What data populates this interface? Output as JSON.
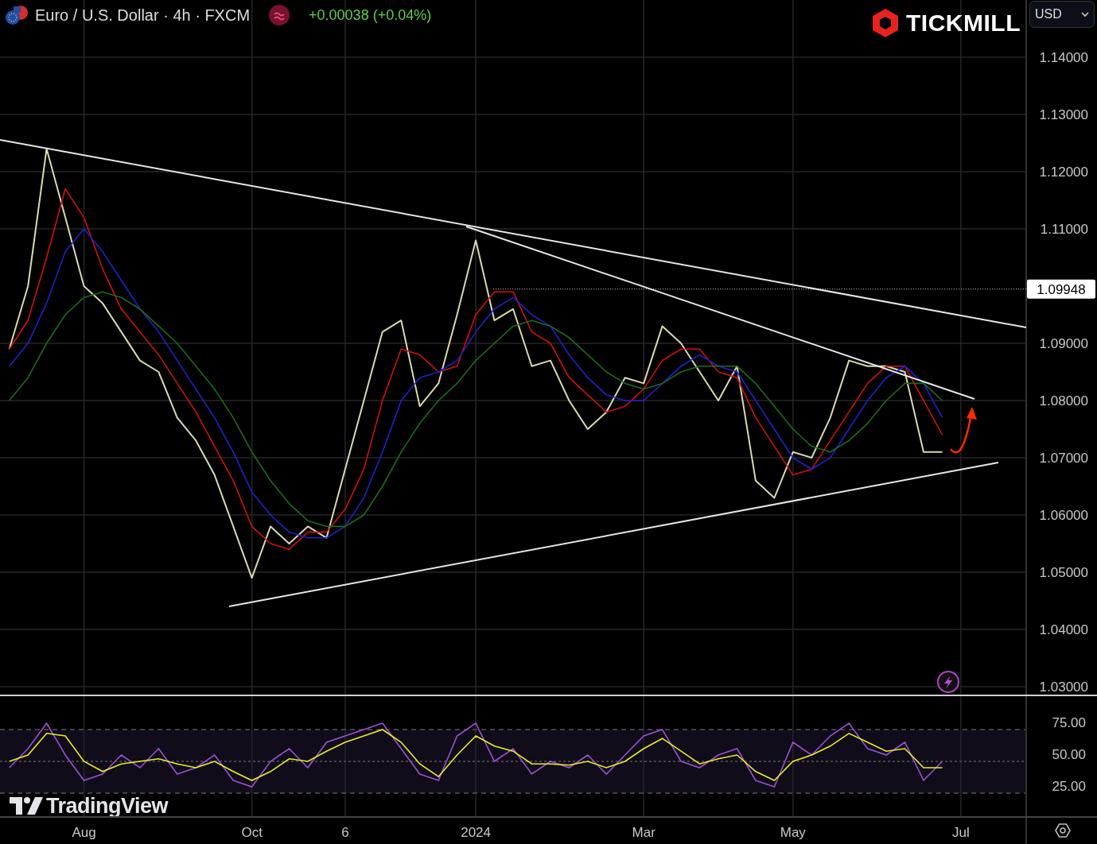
{
  "header": {
    "symbol_title": "Euro / U.S. Dollar · 4h · FXCM",
    "change": "+0.00038 (+0.04%)"
  },
  "broker_logo": {
    "text": "TICKMILL"
  },
  "currency_select": {
    "value": "USD"
  },
  "price_chart": {
    "chart_data": {
      "type": "line",
      "grid": true,
      "categories": [
        null,
        null,
        null,
        null,
        "Aug",
        null,
        null,
        null,
        null,
        null,
        null,
        null,
        null,
        "Oct",
        null,
        null,
        null,
        null,
        "6",
        null,
        null,
        null,
        null,
        null,
        null,
        "2024",
        null,
        null,
        null,
        null,
        null,
        null,
        null,
        null,
        "Mar",
        null,
        null,
        null,
        null,
        null,
        null,
        null,
        "May",
        null,
        null,
        null,
        null,
        null,
        null,
        null,
        null,
        "Jul",
        null,
        null,
        null
      ],
      "ylim": [
        1.02833,
        1.15
      ],
      "yticks": [
        {
          "value": 1.14,
          "label": "1.14000"
        },
        {
          "value": 1.13,
          "label": "1.13000"
        },
        {
          "value": 1.12,
          "label": "1.12000"
        },
        {
          "value": 1.11,
          "label": "1.11000"
        },
        {
          "value": 1.09,
          "label": "1.09000"
        },
        {
          "value": 1.08,
          "label": "1.08000"
        },
        {
          "value": 1.07,
          "label": "1.07000"
        },
        {
          "value": 1.06,
          "label": "1.06000"
        },
        {
          "value": 1.05,
          "label": "1.05000"
        },
        {
          "value": 1.04,
          "label": "1.04000"
        },
        {
          "value": 1.03,
          "label": "1.03000"
        }
      ],
      "series": [
        {
          "color": "#d9d9b0",
          "values": [
            1.089,
            1.1,
            1.124,
            1.112,
            1.1,
            1.097,
            1.092,
            1.087,
            1.085,
            1.077,
            1.073,
            1.067,
            1.058,
            1.049,
            1.058,
            1.055,
            1.058,
            1.056,
            1.068,
            1.08,
            1.092,
            1.094,
            1.079,
            1.083,
            1.095,
            1.108,
            1.094,
            1.096,
            1.086,
            1.087,
            1.08,
            1.075,
            1.078,
            1.084,
            1.083,
            1.093,
            1.09,
            1.085,
            1.08,
            1.086,
            1.066,
            1.063,
            1.071,
            1.07,
            1.077,
            1.087,
            1.086,
            1.086,
            1.085,
            1.071,
            1.071,
            null,
            null,
            null,
            null
          ]
        },
        {
          "color": "#d01010",
          "values": [
            1.089,
            1.094,
            1.105,
            1.117,
            1.112,
            1.103,
            1.096,
            1.092,
            1.088,
            1.083,
            1.078,
            1.072,
            1.066,
            1.058,
            1.055,
            1.054,
            1.057,
            1.057,
            1.061,
            1.068,
            1.08,
            1.089,
            1.088,
            1.085,
            1.086,
            1.095,
            1.099,
            1.099,
            1.092,
            1.09,
            1.084,
            1.081,
            1.078,
            1.079,
            1.082,
            1.087,
            1.089,
            1.089,
            1.085,
            1.084,
            1.077,
            1.072,
            1.067,
            1.068,
            1.073,
            1.078,
            1.083,
            1.086,
            1.086,
            1.08,
            1.074,
            null,
            null,
            null,
            null
          ]
        },
        {
          "color": "#2020d0",
          "values": [
            1.086,
            1.09,
            1.097,
            1.106,
            1.11,
            1.106,
            1.101,
            1.096,
            1.092,
            1.087,
            1.082,
            1.077,
            1.071,
            1.064,
            1.06,
            1.057,
            1.056,
            1.056,
            1.058,
            1.063,
            1.071,
            1.08,
            1.084,
            1.085,
            1.087,
            1.092,
            1.096,
            1.098,
            1.095,
            1.093,
            1.088,
            1.084,
            1.081,
            1.08,
            1.08,
            1.083,
            1.086,
            1.088,
            1.086,
            1.085,
            1.08,
            1.075,
            1.07,
            1.068,
            1.07,
            1.075,
            1.08,
            1.084,
            1.086,
            1.083,
            1.077,
            null,
            null,
            null,
            null
          ]
        },
        {
          "color": "#1d6b1d",
          "values": [
            1.08,
            1.084,
            1.09,
            1.095,
            1.098,
            1.099,
            1.098,
            1.096,
            1.093,
            1.09,
            1.086,
            1.082,
            1.077,
            1.071,
            1.066,
            1.062,
            1.059,
            1.058,
            1.058,
            1.06,
            1.065,
            1.071,
            1.076,
            1.08,
            1.083,
            1.087,
            1.09,
            1.093,
            1.094,
            1.093,
            1.091,
            1.088,
            1.085,
            1.083,
            1.082,
            1.083,
            1.085,
            1.086,
            1.086,
            1.086,
            1.083,
            1.079,
            1.075,
            1.072,
            1.071,
            1.073,
            1.076,
            1.08,
            1.083,
            1.083,
            1.08,
            null,
            null,
            null,
            null
          ]
        }
      ]
    },
    "price_level": {
      "label": "1.09948"
    }
  },
  "rsi_chart": {
    "chart_data": {
      "type": "line",
      "grid": true,
      "ylim": [
        7.5,
        101.25
      ],
      "yticks": [
        {
          "value": 75,
          "label": "75.00"
        },
        {
          "value": 50,
          "label": "50.00"
        },
        {
          "value": 25,
          "label": "25.00"
        }
      ],
      "series": [
        {
          "color": "#9b4fd6",
          "values": [
            45,
            60,
            80,
            55,
            35,
            40,
            55,
            45,
            60,
            40,
            45,
            55,
            35,
            30,
            50,
            60,
            45,
            65,
            70,
            75,
            80,
            60,
            40,
            35,
            70,
            80,
            50,
            60,
            40,
            50,
            45,
            55,
            40,
            55,
            70,
            75,
            50,
            45,
            55,
            60,
            35,
            30,
            65,
            55,
            70,
            80,
            60,
            55,
            65,
            35,
            50,
            null,
            null,
            null,
            null
          ]
        },
        {
          "color": "#e8f020",
          "values": [
            50,
            55,
            72,
            70,
            50,
            42,
            48,
            50,
            52,
            48,
            45,
            50,
            42,
            35,
            42,
            52,
            50,
            58,
            65,
            70,
            75,
            65,
            48,
            38,
            55,
            70,
            62,
            58,
            48,
            48,
            47,
            50,
            45,
            50,
            60,
            68,
            58,
            48,
            52,
            55,
            42,
            35,
            50,
            55,
            62,
            72,
            65,
            58,
            60,
            45,
            45,
            null,
            null,
            null,
            null
          ]
        }
      ]
    }
  },
  "watermark_logo": {
    "text": "TradingView"
  }
}
